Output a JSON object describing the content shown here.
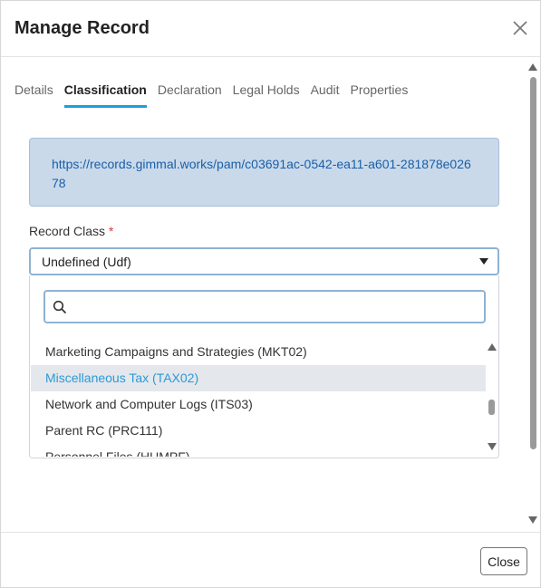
{
  "dialog": {
    "title": "Manage Record",
    "close_icon": "close-icon"
  },
  "tabs": [
    {
      "label": "Details",
      "active": false
    },
    {
      "label": "Classification",
      "active": true
    },
    {
      "label": "Declaration",
      "active": false
    },
    {
      "label": "Legal Holds",
      "active": false
    },
    {
      "label": "Audit",
      "active": false
    },
    {
      "label": "Properties",
      "active": false
    }
  ],
  "record_url": "https://records.gimmal.works/pam/c03691ac-0542-ea11-a601-281878e02678",
  "record_class": {
    "label": "Record Class",
    "required_marker": "*",
    "selected": "Undefined (Udf)",
    "search": {
      "value": "",
      "placeholder": "",
      "icon": "search-icon"
    },
    "options": [
      {
        "label": "Marketing Campaigns and Strategies (MKT02)",
        "highlighted": false
      },
      {
        "label": "Miscellaneous Tax (TAX02)",
        "highlighted": true
      },
      {
        "label": "Network and Computer Logs (ITS03)",
        "highlighted": false
      },
      {
        "label": "Parent RC (PRC111)",
        "highlighted": false
      },
      {
        "label": "Personnel Files (HUMPF)",
        "highlighted": false
      }
    ]
  },
  "footer": {
    "close_label": "Close"
  },
  "colors": {
    "accent": "#1a9fe0",
    "url_box_bg": "#c9d9ea",
    "link": "#1a5fa8",
    "highlight_text": "#2a9ad8",
    "required": "#d63a3a"
  }
}
